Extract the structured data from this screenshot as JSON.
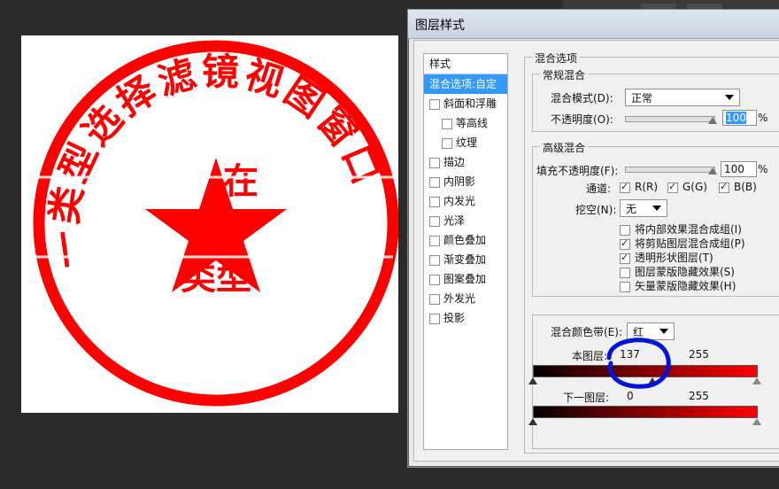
{
  "canvas": {
    "stamp": {
      "arc_text": "一类型选择滤镜视图窗口",
      "stray_text_top": "在",
      "stray_text_bottom": "类型",
      "colors": {
        "red": "#ff0000"
      }
    }
  },
  "dialog": {
    "title": "图层样式",
    "styles_header": "样式",
    "styles": [
      {
        "label": "混合选项:自定",
        "selected": true
      },
      {
        "label": "斜面和浮雕",
        "checked": false
      },
      {
        "label": "等高线",
        "checked": false,
        "sub": true
      },
      {
        "label": "纹理",
        "checked": false,
        "sub": true
      },
      {
        "label": "描边",
        "checked": false
      },
      {
        "label": "内阴影",
        "checked": false
      },
      {
        "label": "内发光",
        "checked": false
      },
      {
        "label": "光泽",
        "checked": false
      },
      {
        "label": "颜色叠加",
        "checked": false
      },
      {
        "label": "渐变叠加",
        "checked": false
      },
      {
        "label": "图案叠加",
        "checked": false
      },
      {
        "label": "外发光",
        "checked": false
      },
      {
        "label": "投影",
        "checked": false
      }
    ],
    "blend_options_title": "混合选项",
    "general": {
      "title": "常规混合",
      "mode_label": "混合模式(D):",
      "mode_value": "正常",
      "opacity_label": "不透明度(O):",
      "opacity_value": "100",
      "percent": "%"
    },
    "advanced": {
      "title": "高级混合",
      "fill_label": "填充不透明度(F):",
      "fill_value": "100",
      "percent": "%",
      "channels_label": "通道:",
      "channels": [
        {
          "label": "R(R)",
          "checked": true
        },
        {
          "label": "G(G)",
          "checked": true
        },
        {
          "label": "B(B)",
          "checked": true
        }
      ],
      "knockout_label": "挖空(N):",
      "knockout_value": "无",
      "options": [
        {
          "label": "将内部效果混合成组(I)",
          "checked": false
        },
        {
          "label": "将剪贴图层混合成组(P)",
          "checked": true
        },
        {
          "label": "透明形状图层(T)",
          "checked": true
        },
        {
          "label": "图层蒙版隐藏效果(S)",
          "checked": false
        },
        {
          "label": "矢量蒙版隐藏效果(H)",
          "checked": false
        }
      ]
    },
    "blend_if": {
      "label": "混合颜色带(E):",
      "value": "红",
      "this_layer_label": "本图层:",
      "this_layer_low": "137",
      "this_layer_high": "255",
      "this_layer_low_fraction": 0.537,
      "underlying_label": "下一图层:",
      "underlying_low": "0",
      "underlying_high": "255"
    },
    "annotation_color": "#0014d8"
  }
}
